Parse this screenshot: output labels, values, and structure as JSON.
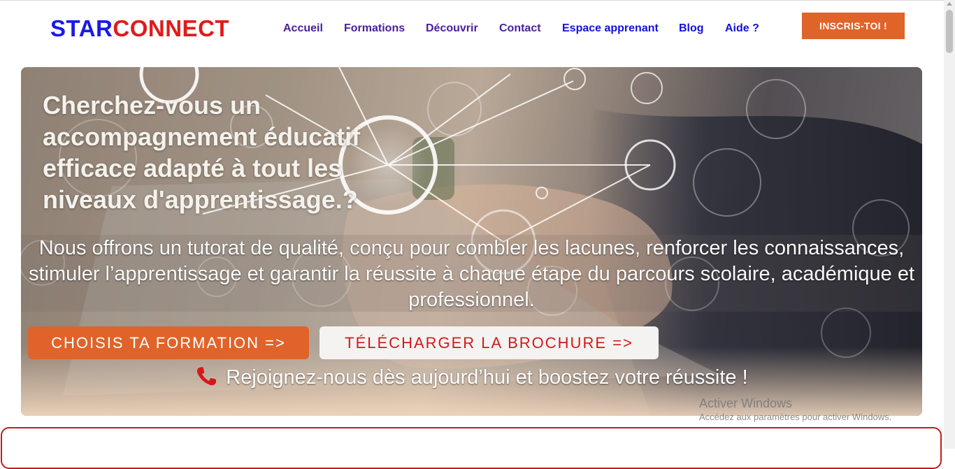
{
  "header": {
    "logo_part1": "STAR",
    "logo_part2": "CONNECT",
    "nav": [
      {
        "label": "Accueil"
      },
      {
        "label": "Formations"
      },
      {
        "label": "Découvrir"
      },
      {
        "label": "Contact"
      },
      {
        "label": "Espace apprenant"
      },
      {
        "label": "Blog"
      },
      {
        "label": "Aide ?"
      }
    ],
    "cta_label": "INSCRIS-TOI !"
  },
  "hero": {
    "title": "Cherchez-vous un accompagnement éducatif efficace adapté à tout les niveaux d'apprentissage.?",
    "subtitle": "Nous offrons un tutorat de qualité, conçu pour combler les lacunes, renforcer les connaissances, stimuler l’apprentissage et garantir la réussite à chaque étape du parcours scolaire, académique et professionnel.",
    "primary_button": "CHOISIS TA FORMATION =>",
    "secondary_button": "TÉLÉCHARGER LA BROCHURE =>",
    "join_text": "Rejoignez-nous dès aujourd’hui et boostez votre réussite !",
    "join_icon": "phone-icon"
  },
  "watermark": {
    "line1": "Activer Windows",
    "line2": "Accédez aux paramètres pour activer Windows."
  },
  "colors": {
    "brand_blue": "#1a1ae6",
    "brand_red": "#e01b1b",
    "nav_purple": "#4a1f95",
    "nav_blue": "#1212d8",
    "accent_orange": "#e0632a",
    "section_border_red": "#c81a1a"
  }
}
